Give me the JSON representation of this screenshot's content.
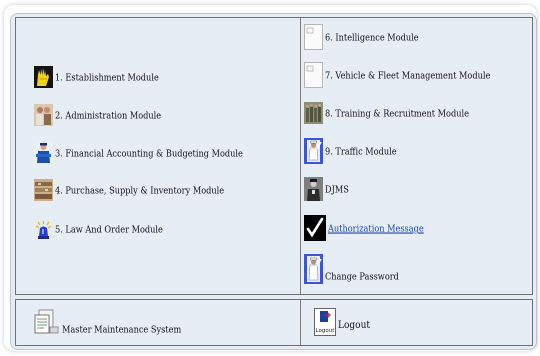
{
  "left_modules": [
    {
      "label": "1.  Establishment Module",
      "icon": "hands-icon"
    },
    {
      "label": "2. Administration Module",
      "icon": "officers-photo-icon"
    },
    {
      "label": "3. Financial Accounting & Budgeting Module",
      "icon": "police-officer-icon"
    },
    {
      "label": "4. Purchase, Supply & Inventory Module",
      "icon": "warehouse-icon"
    },
    {
      "label": "5. Law And Order Module",
      "icon": "siren-icon"
    }
  ],
  "right_modules": [
    {
      "label": "6. Intelligence Module",
      "icon": "blank-document-icon"
    },
    {
      "label": "7. Vehicle & Fleet Management Module",
      "icon": "blank-document-icon"
    },
    {
      "label": "8. Training & Recruitment Module",
      "icon": "trainees-photo-icon"
    },
    {
      "label": "9. Traffic Module",
      "icon": "traffic-police-icon"
    },
    {
      "label": "DJMS",
      "icon": "officer-photo-icon"
    },
    {
      "label": "Authorization Message",
      "icon": "checkmark-icon"
    },
    {
      "label": "Change Password",
      "icon": "traffic-police-icon"
    }
  ],
  "footer": {
    "master": {
      "label": "Master Maintenance System",
      "icon": "documents-icon"
    },
    "logout": {
      "label": "Logout",
      "icon_text": "Logout",
      "icon": "logout-door-icon"
    }
  },
  "colors": {
    "panel_bg": "#e6edf5",
    "link": "#1a47a8",
    "border": "#6f6f6f"
  }
}
